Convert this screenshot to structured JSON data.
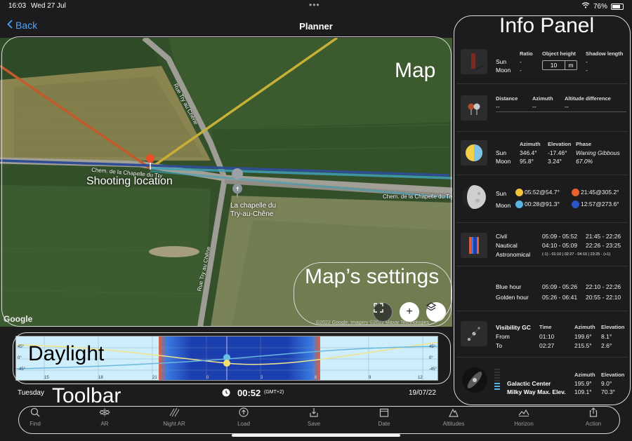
{
  "status": {
    "time": "16:03",
    "date": "Wed 27 Jul",
    "battery": "76%"
  },
  "nav": {
    "back_label": "Back",
    "title": "Planner"
  },
  "map": {
    "shooting_location": "Shooting location",
    "chapel_line1": "La chapelle du",
    "chapel_line2": "Try-au-Chêne",
    "road1": "Rue Try au Chêne",
    "road2": "Chem. de la Chapelle du Try",
    "road3": "Chem. de la Chapelle du Try",
    "road4": "Rue Try au Chêne",
    "google": "Google",
    "copyright": "©2022 Google, Imagery ©2022 Maxar Technologies"
  },
  "annotations": {
    "map": "Map",
    "info_panel": "Info Panel",
    "map_settings": "Map’s settings",
    "daylight": "Daylight",
    "toolbar": "Toolbar"
  },
  "daylight": {
    "ticks": [
      "15",
      "18",
      "21",
      "0",
      "3",
      "6",
      "9",
      "12"
    ],
    "alt_labels_left": [
      "45°",
      "0°",
      "-45°"
    ],
    "alt_labels_right": [
      "45°",
      "0°",
      "-45°"
    ]
  },
  "timebar": {
    "day": "Tuesday",
    "time": "00:52",
    "tz": "(GMT+2)",
    "date": "19/07/22"
  },
  "toolbar": {
    "items": [
      {
        "label": "Find",
        "icon": "search-icon"
      },
      {
        "label": "AR",
        "icon": "ar-icon"
      },
      {
        "label": "Night AR",
        "icon": "night-ar-icon"
      },
      {
        "label": "Load",
        "icon": "load-icon"
      },
      {
        "label": "Save",
        "icon": "save-icon"
      },
      {
        "label": "Date",
        "icon": "calendar-icon"
      },
      {
        "label": "Altitudes",
        "icon": "mountain-icon"
      },
      {
        "label": "Horizon",
        "icon": "horizon-icon"
      },
      {
        "label": "Action",
        "icon": "share-icon"
      }
    ]
  },
  "info": {
    "shadow": {
      "ratio_h": "Ratio",
      "object_height_h": "Object height",
      "shadow_length_h": "Shadow length",
      "sun": "Sun",
      "moon": "Moon",
      "sun_ratio": "-",
      "moon_ratio": "-",
      "height_value": "10",
      "height_unit": "m",
      "sun_shadow": "-",
      "moon_shadow": "-"
    },
    "distance": {
      "distance_h": "Distance",
      "azimuth_h": "Azimuth",
      "altitude_diff_h": "Altitude difference",
      "distance": "--",
      "azimuth": "--",
      "altitude_diff": "--"
    },
    "position": {
      "azimuth_h": "Azimuth",
      "elevation_h": "Elevation",
      "phase_h": "Phase",
      "sun": "Sun",
      "moon": "Moon",
      "sun_az": "346.4°",
      "sun_el": "-17.46°",
      "phase_name": "Waning Gibbous",
      "moon_az": "95.8°",
      "moon_el": "3.24°",
      "phase_pct": "67.0%"
    },
    "rise_set": {
      "sun": "Sun",
      "moon": "Moon",
      "sun_rise": "05:52@54.7°",
      "sun_set": "21:45@305.2°",
      "moon_rise": "00:28@91.3°",
      "moon_set": "12:57@273.6°"
    },
    "twilight": {
      "civil": "Civil",
      "nautical": "Nautical",
      "astronomical": "Astronomical",
      "civil_am": "05:09 - 05:52",
      "civil_pm": "21:45 - 22:26",
      "nautical_am": "04:10 - 05:09",
      "nautical_pm": "22:26 - 23:25",
      "astro": "(-1) - 01:10 | 02:27 - 04:10 | 23:25 - (+1)"
    },
    "hours": {
      "blue": "Blue hour",
      "golden": "Golden hour",
      "blue_am": "05:09 - 05:26",
      "blue_pm": "22:10 - 22:26",
      "golden_am": "05:26 - 06:41",
      "golden_pm": "20:55 - 22:10"
    },
    "gc": {
      "visibility": "Visibility GC",
      "from": "From",
      "to": "To",
      "time_h": "Time",
      "azimuth_h": "Azimuth",
      "elevation_h": "Elevation",
      "from_time": "01:10",
      "from_az": "199.6°",
      "from_el": "8.1°",
      "to_time": "02:27",
      "to_az": "215.5°",
      "to_el": "2.6°"
    },
    "milkyway": {
      "azimuth_h": "Azimuth",
      "elevation_h": "Elevation",
      "center": "Galactic Center",
      "max": "Milky Way Max. Elev.",
      "center_az": "195.9°",
      "center_el": "9.0°",
      "max_az": "109.1°",
      "max_el": "70.3°"
    }
  },
  "colors": {
    "accent_blue": "#4aa3ff",
    "sun_line": "#c8b038",
    "shoot_line": "#c25a2c",
    "moon_line": "#3c5aa0",
    "teal_line": "#3fa0b8",
    "pin": "#e8502a"
  }
}
